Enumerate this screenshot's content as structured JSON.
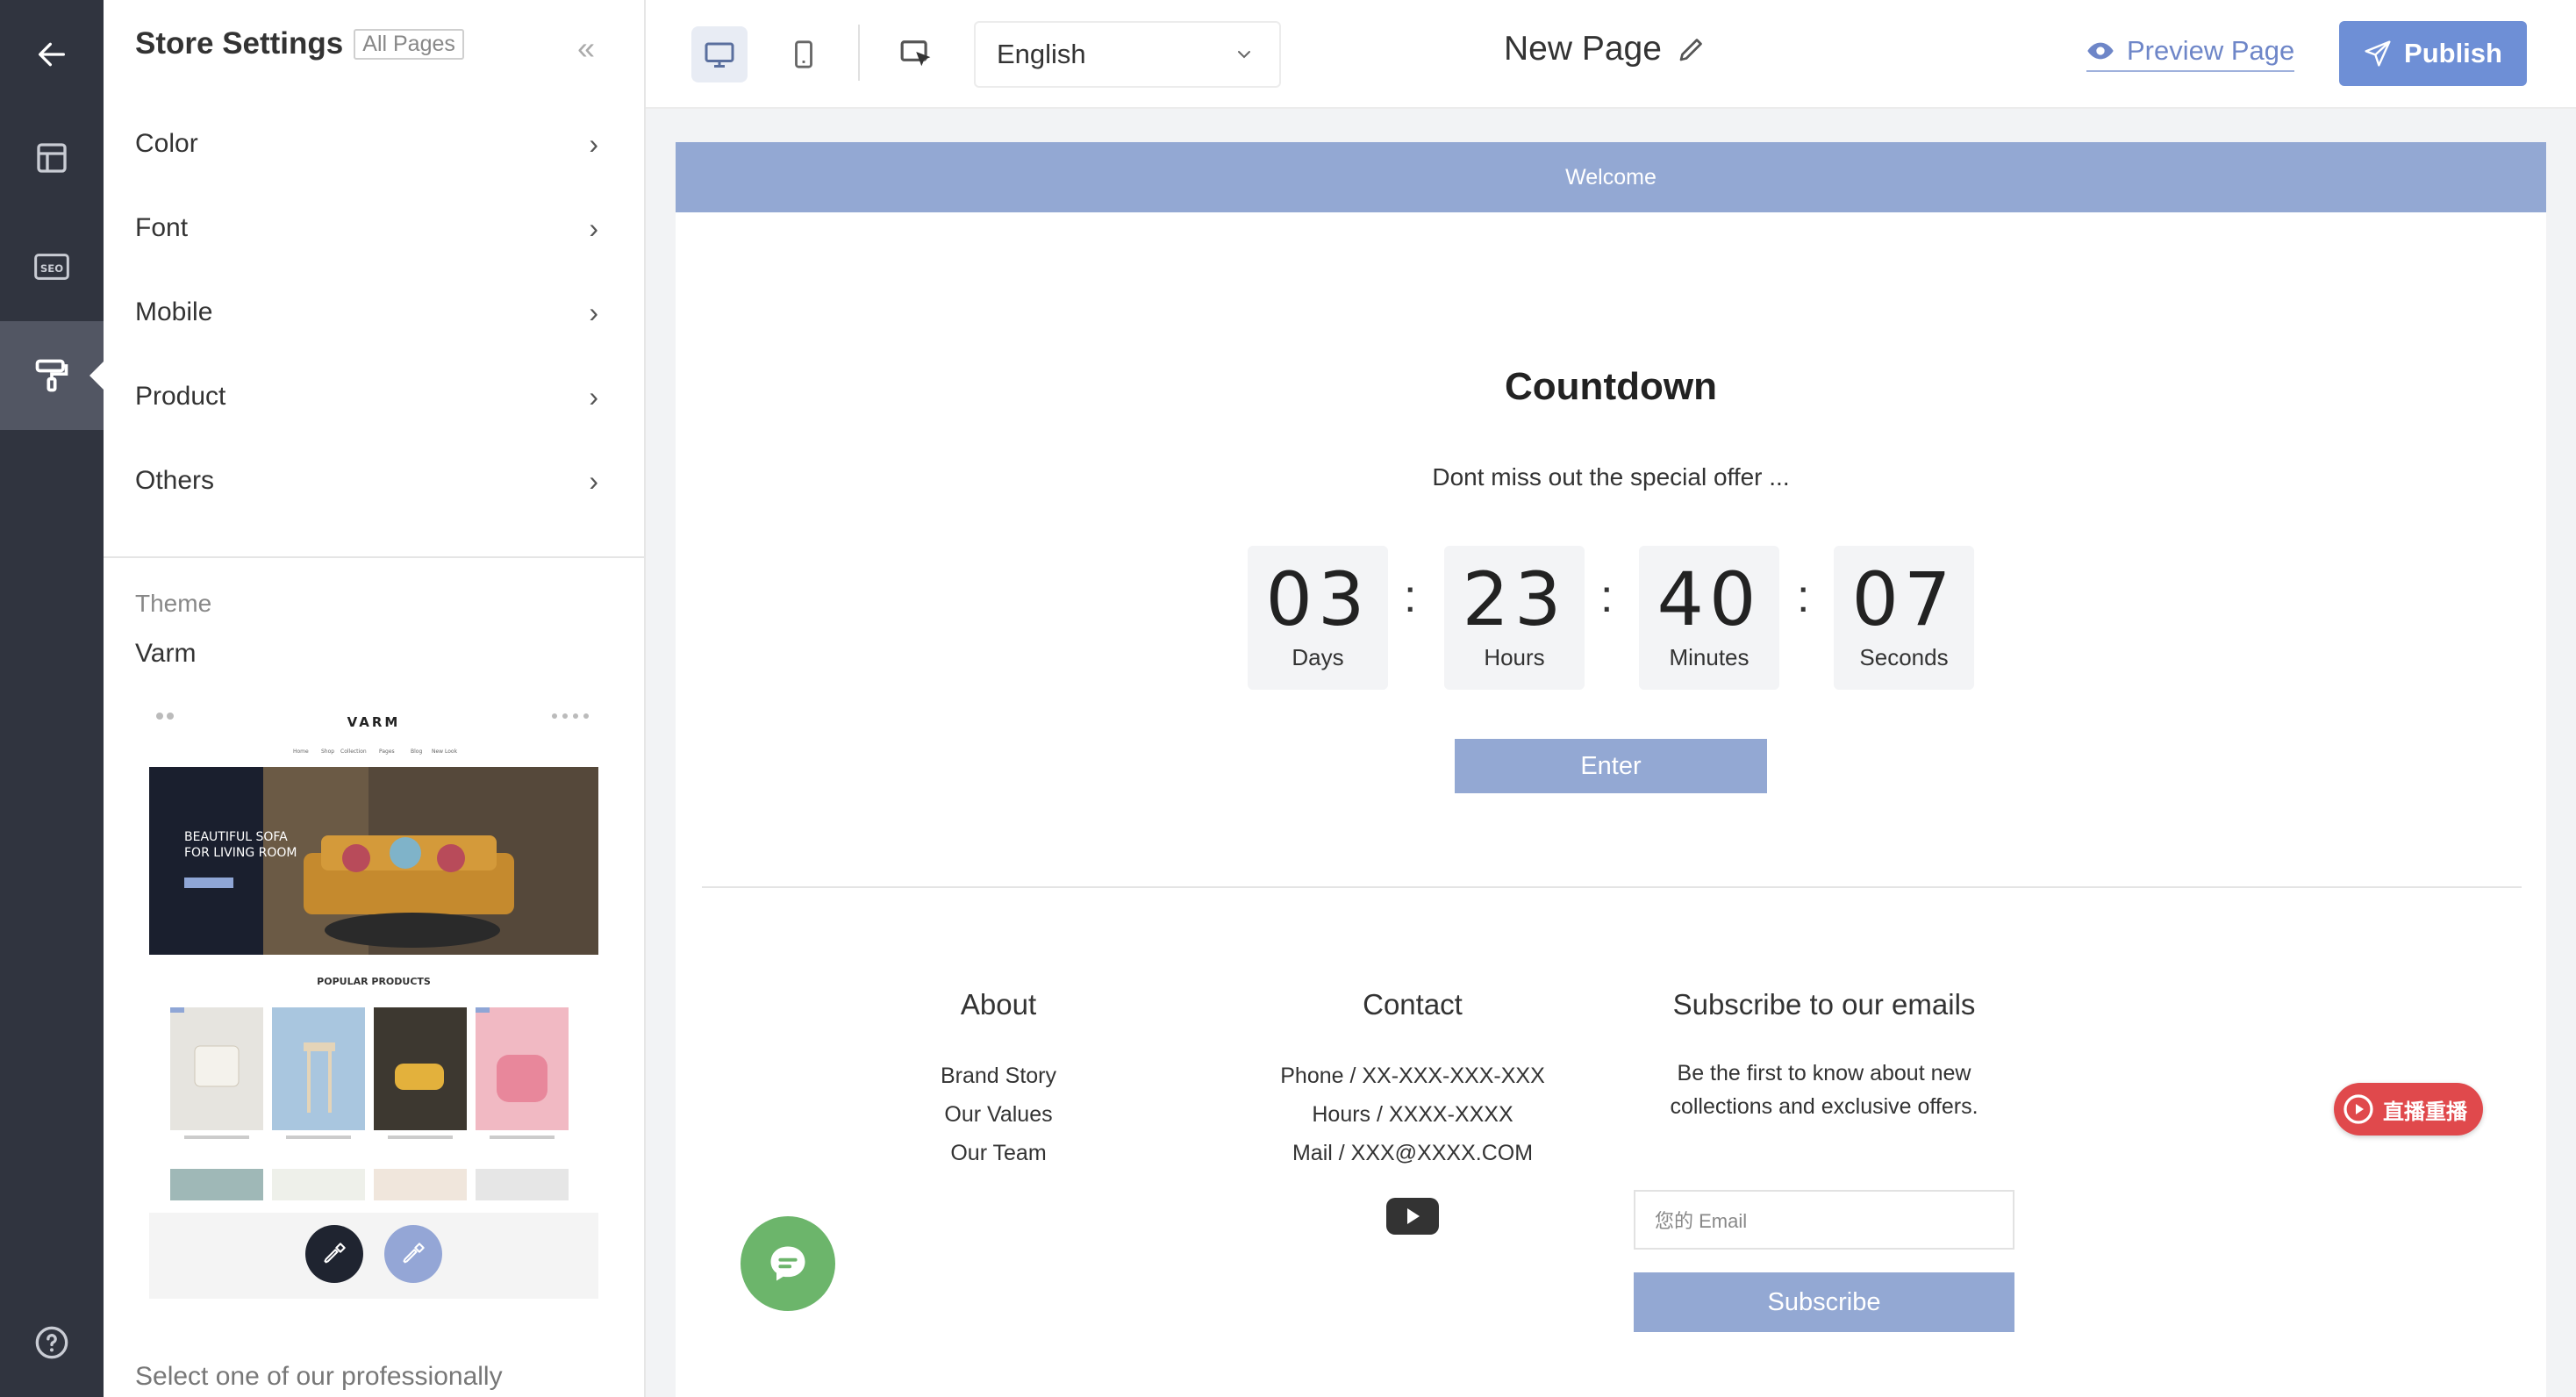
{
  "sidebar": {
    "title": "Store Settings",
    "tag": "All Pages",
    "collapse_icon": "«",
    "items": [
      {
        "label": "Color"
      },
      {
        "label": "Font"
      },
      {
        "label": "Mobile"
      },
      {
        "label": "Product"
      },
      {
        "label": "Others"
      }
    ],
    "theme_label": "Theme",
    "theme_name": "Varm",
    "footer_text": "Select one of our professionally",
    "theme_preview": {
      "brand": "VARM",
      "nav": [
        "Home",
        "Shop",
        "Collection",
        "Pages",
        "Blog",
        "New Look"
      ],
      "hero_text_1": "BEAUTIFUL SOFA",
      "hero_text_2": "FOR LIVING ROOM",
      "section_title": "POPULAR PRODUCTS"
    }
  },
  "toolbar": {
    "language": "English",
    "page_name": "New Page",
    "preview_label": "Preview Page",
    "publish_label": "Publish"
  },
  "page": {
    "welcome": "Welcome",
    "countdown": {
      "title": "Countdown",
      "subtitle": "Dont miss out the special offer ...",
      "days": "03",
      "days_label": "Days",
      "hours": "23",
      "hours_label": "Hours",
      "minutes": "40",
      "minutes_label": "Minutes",
      "seconds": "07",
      "seconds_label": "Seconds",
      "button": "Enter"
    },
    "footer": {
      "about": {
        "title": "About",
        "items": [
          "Brand Story",
          "Our Values",
          "Our Team"
        ]
      },
      "contact": {
        "title": "Contact",
        "items": [
          "Phone / XX-XXX-XXX-XXX",
          "Hours / XXXX-XXXX",
          "Mail / XXX@XXXX.COM"
        ]
      },
      "subscribe": {
        "title": "Subscribe to our emails",
        "desc_1": "Be the first to know about new",
        "desc_2": "collections and exclusive offers.",
        "placeholder": "您的 Email",
        "button": "Subscribe"
      }
    },
    "live_badge": "直播重播"
  },
  "colors": {
    "rail": "#30343f",
    "accent": "#6e8fd6",
    "banner": "#93a8d3",
    "chat": "#6cb56b",
    "live": "#e0494c"
  }
}
